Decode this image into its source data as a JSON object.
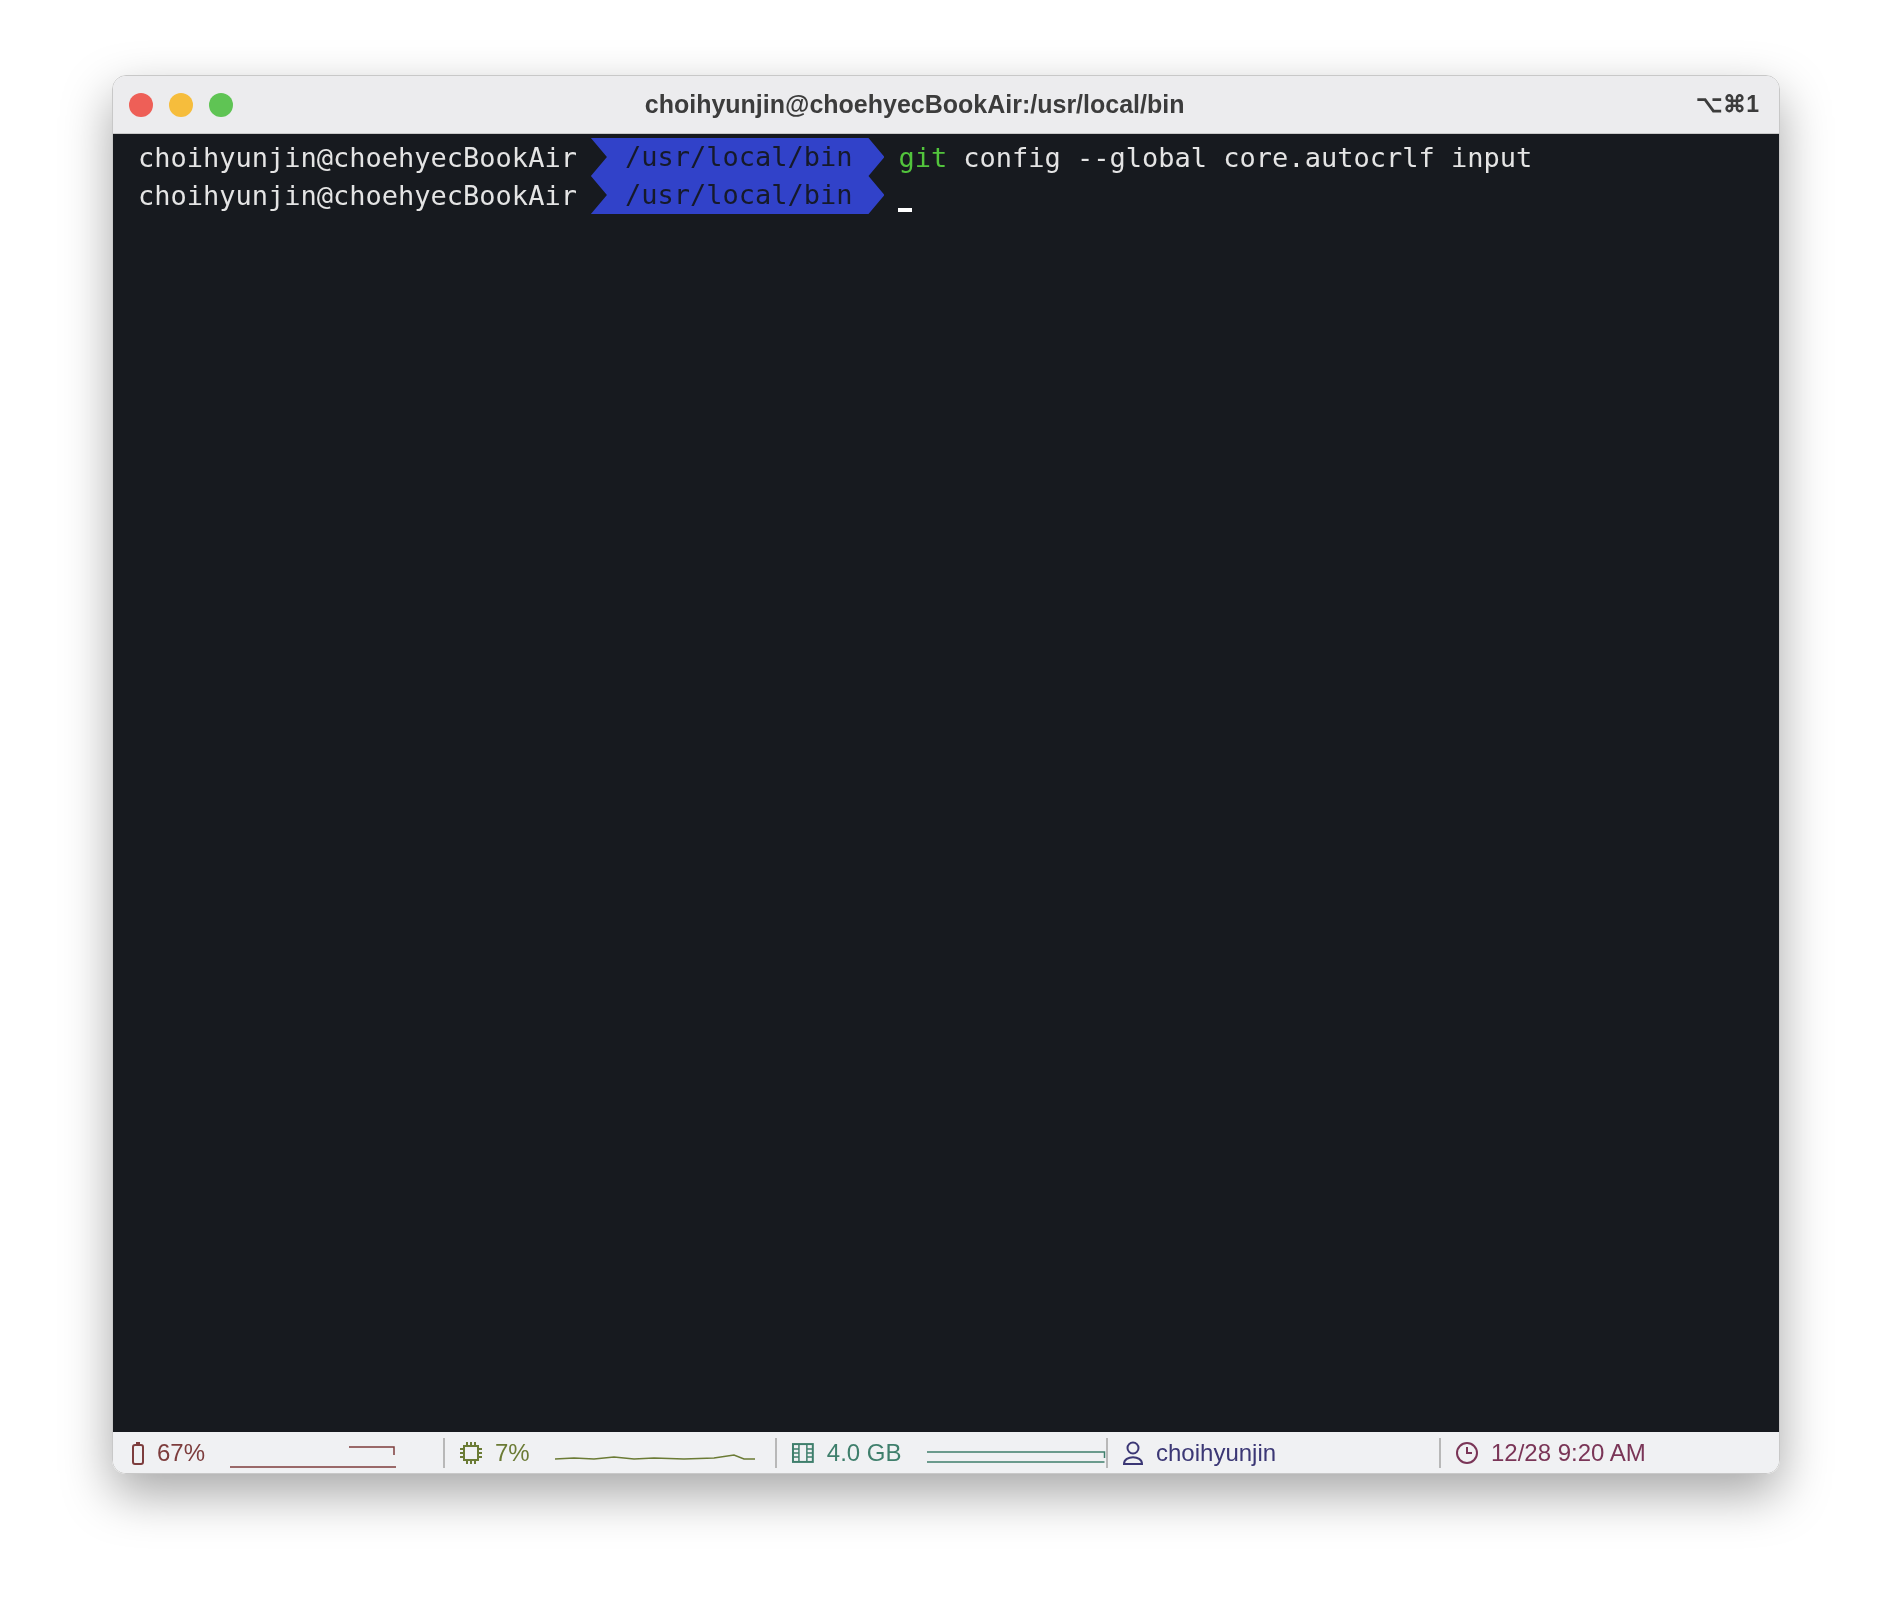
{
  "window": {
    "title": "choihyunjin@choehyecBookAir:/usr/local/bin",
    "shortcut": "⌥⌘1"
  },
  "lines": [
    {
      "user": "choihyunjin@choehyecBookAir",
      "path": "/usr/local/bin",
      "program": "git",
      "args": "config --global core.autocrlf input"
    },
    {
      "user": "choihyunjin@choehyecBookAir",
      "path": "/usr/local/bin"
    }
  ],
  "status_bar": [
    {
      "kind": "battery",
      "text": "67%",
      "color": "#7d3d3d"
    },
    {
      "kind": "cpu",
      "text": "7%",
      "color": "#6b7b35"
    },
    {
      "kind": "memory",
      "text": "4.0 GB",
      "color": "#3f7f6c"
    },
    {
      "kind": "user",
      "text": "choihyunjin",
      "color": "#3b3775"
    },
    {
      "kind": "clock",
      "text": "12/28 9:20 AM",
      "color": "#7a3557"
    }
  ]
}
